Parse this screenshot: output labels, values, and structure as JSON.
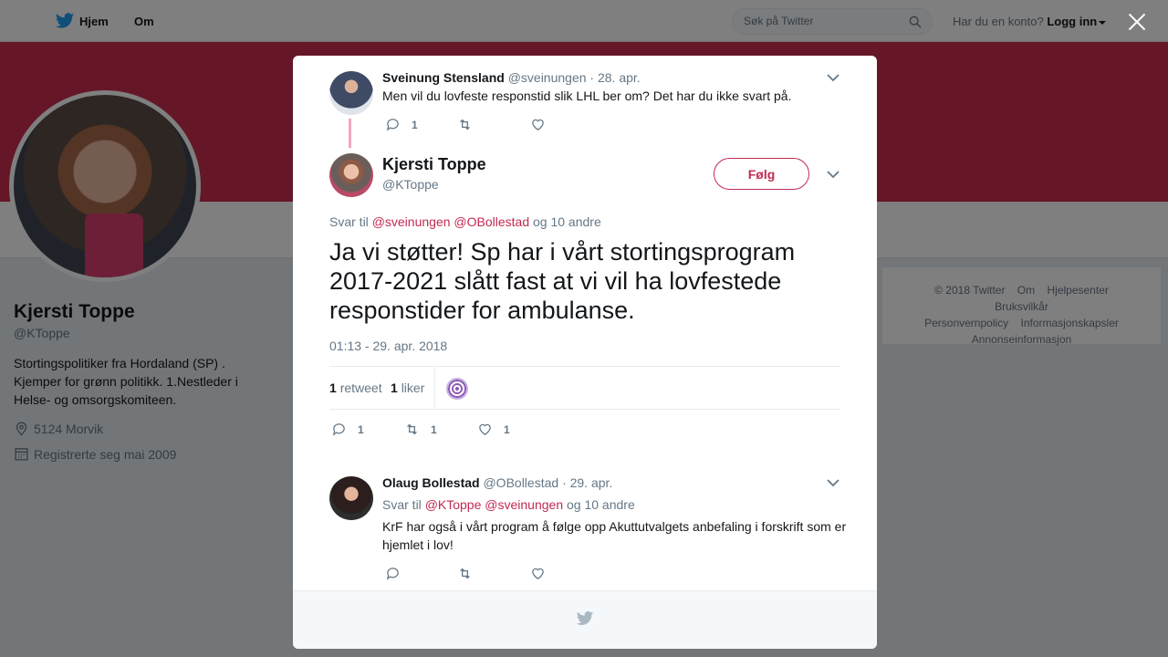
{
  "topnav": {
    "home_label": "Hjem",
    "about_label": "Om",
    "search_placeholder": "Søk på Twitter",
    "account_question": "Har du en konto?",
    "login_label": "Logg inn"
  },
  "profile": {
    "name": "Kjersti Toppe",
    "handle": "@KToppe",
    "bio": "Stortingspolitiker fra Hordaland (SP) . Kjemper for grønn politikk. 1.Nestleder i Helse- og omsorgskomiteen.",
    "location": "5124 Morvik",
    "joined": "Registrerte seg mai 2009"
  },
  "footer": {
    "copyright": "© 2018 Twitter",
    "about": "Om",
    "help": "Hjelpesenter",
    "terms": "Bruksvilkår",
    "privacy": "Personvernpolicy",
    "cookies": "Informasjonskapsler",
    "ads": "Annonseinformasjon"
  },
  "parent_tweet": {
    "name": "Sveinung Stensland",
    "handle": "@sveinungen",
    "date": "· 28. apr.",
    "text": "Men vil du lovfeste responstid slik LHL ber om? Det har du ikke svart på.",
    "reply_count": "1"
  },
  "main_tweet": {
    "name": "Kjersti Toppe",
    "handle": "@KToppe",
    "follow_label": "Følg",
    "reply_prefix": "Svar til",
    "reply_mention_1": "@sveinungen",
    "reply_mention_2": "@OBollestad",
    "reply_suffix": "og 10 andre",
    "text": "Ja vi støtter! Sp har i vårt stortingsprogram 2017-2021 slått fast  at vi vil ha lovfestede responstider for ambulanse.",
    "timestamp": "01:13 - 29. apr. 2018",
    "retweet_count": "1",
    "retweet_label": "retweet",
    "like_count": "1",
    "like_label": "liker",
    "reply_action_count": "1",
    "retweet_action_count": "1",
    "like_action_count": "1"
  },
  "reply_tweet": {
    "name": "Olaug Bollestad",
    "handle": "@OBollestad",
    "date": "· 29. apr.",
    "reply_prefix": "Svar til",
    "reply_mention_1": "@KToppe",
    "reply_mention_2": "@sveinungen",
    "reply_suffix": "og 10 andre",
    "text": "KrF har også i vårt program å følge opp Akuttutvalgets anbefaling i forskrift som er hjemlet i lov!"
  },
  "colors": {
    "brand": "#1da1f2",
    "accent": "#c22a52",
    "banner": "#ca2f50"
  }
}
